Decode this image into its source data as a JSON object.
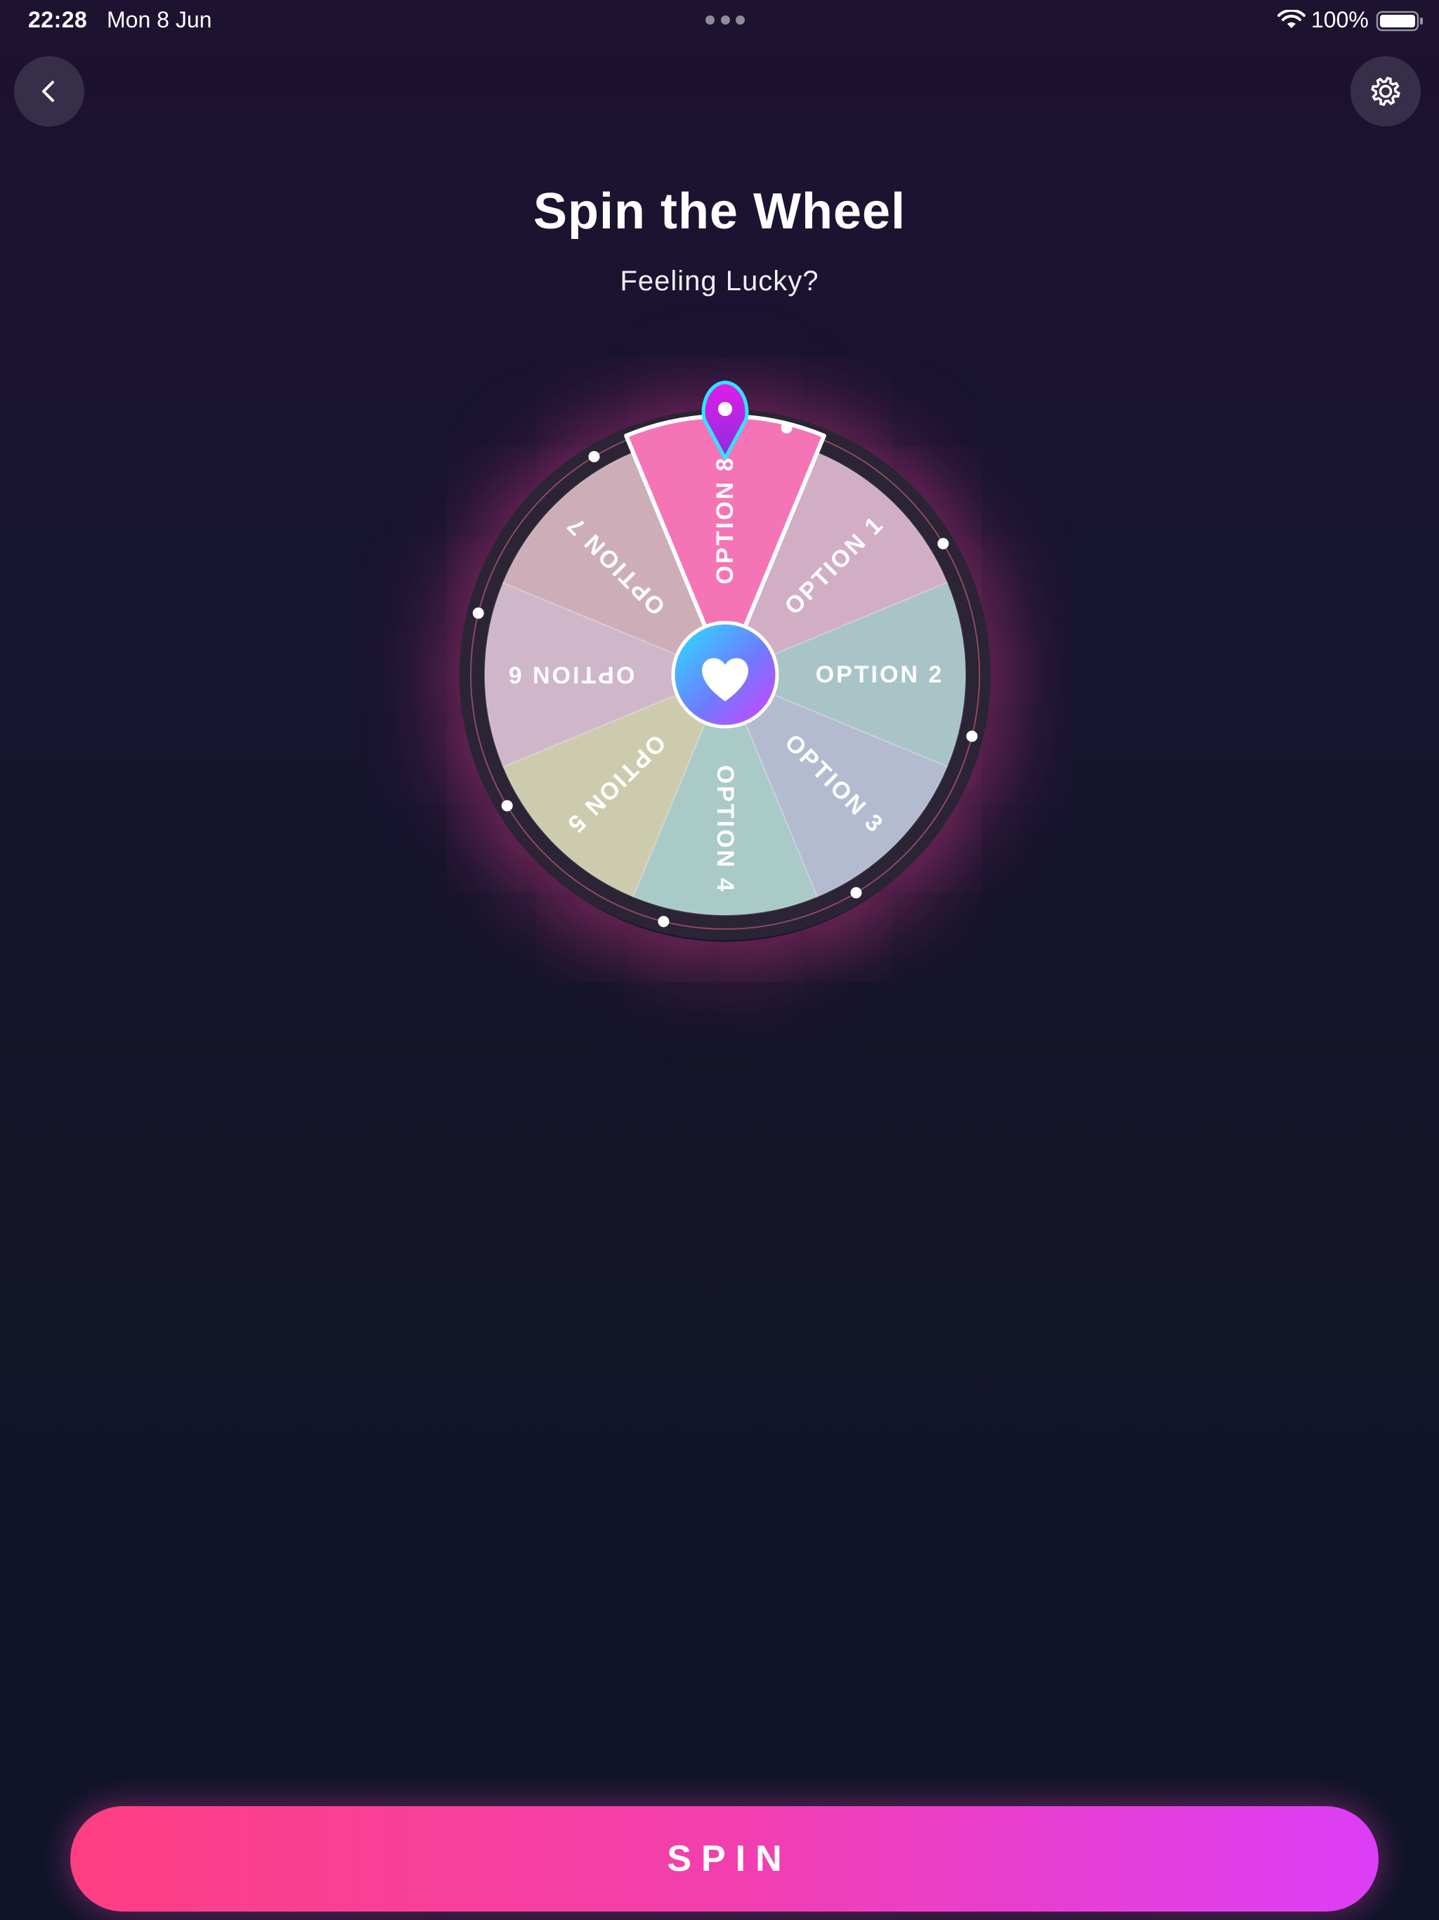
{
  "status_bar": {
    "time": "22:28",
    "date": "Mon 8 Jun",
    "battery": "100%",
    "icons": [
      "wifi-icon",
      "battery-icon",
      "more-dots-icon"
    ]
  },
  "header": {
    "back_icon": "chevron-left-icon",
    "settings_icon": "gear-icon"
  },
  "title": "Spin the Wheel",
  "subtitle": "Feeling Lucky?",
  "wheel": {
    "selected": "OPTION 8",
    "center_icon": "heart-icon",
    "pointer_icon": "map-pin-pointer-icon",
    "segments": [
      {
        "label": "OPTION 1",
        "color": "#d2aec5"
      },
      {
        "label": "OPTION 2",
        "color": "#a8c4c6"
      },
      {
        "label": "OPTION 3",
        "color": "#b4bbd0"
      },
      {
        "label": "OPTION 4",
        "color": "#a9cac6"
      },
      {
        "label": "OPTION 5",
        "color": "#cdcbae"
      },
      {
        "label": "OPTION 6",
        "color": "#d0b6c9"
      },
      {
        "label": "OPTION 7",
        "color": "#cdaeb8"
      },
      {
        "label": "OPTION 8",
        "color": "#f574b6"
      }
    ]
  },
  "colors": {
    "accent_pink": "#ff3f82",
    "accent_purple": "#dc3ef7",
    "pointer_cyan": "#2ee6ff",
    "pointer_magenta": "#d21ee0"
  },
  "spin_button": {
    "label": "SPIN"
  }
}
